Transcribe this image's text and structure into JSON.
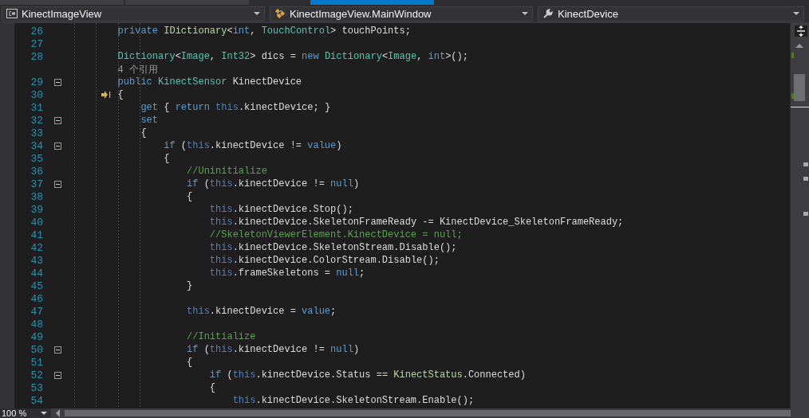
{
  "document_tabs": [
    {
      "selected": false
    },
    {
      "selected": false
    },
    {
      "selected": true
    }
  ],
  "navigation_bar": [
    {
      "kind": "project",
      "label": "KinectImageView"
    },
    {
      "kind": "class",
      "label": "KinectImageView.MainWindow"
    },
    {
      "kind": "member",
      "label": "KinectDevice"
    }
  ],
  "editor": {
    "lines": [
      {
        "kind": "code",
        "number": "26",
        "tokens": [
          {
            "kind": "kw",
            "text": "        private"
          },
          {
            "kind": "iface",
            "text": " IDictionary"
          },
          {
            "kind": "plain",
            "text": "<"
          },
          {
            "kind": "kw",
            "text": "int"
          },
          {
            "kind": "plain",
            "text": ", "
          },
          {
            "kind": "type",
            "text": "TouchControl"
          },
          {
            "kind": "plain",
            "text": "> touchPoints;"
          }
        ]
      },
      {
        "kind": "code",
        "number": "27"
      },
      {
        "kind": "code",
        "number": "28",
        "tokens": [
          {
            "kind": "type",
            "text": "        Dictionary"
          },
          {
            "kind": "plain",
            "text": "<"
          },
          {
            "kind": "type",
            "text": "Image"
          },
          {
            "kind": "plain",
            "text": ", "
          },
          {
            "kind": "type",
            "text": "Int32"
          },
          {
            "kind": "plain",
            "text": "> dics = "
          },
          {
            "kind": "kw",
            "text": "new"
          },
          {
            "kind": "type",
            "text": " Dictionary"
          },
          {
            "kind": "plain",
            "text": "<"
          },
          {
            "kind": "type",
            "text": "Image"
          },
          {
            "kind": "plain",
            "text": ", "
          },
          {
            "kind": "kw",
            "text": "int"
          },
          {
            "kind": "plain",
            "text": ">();"
          }
        ]
      },
      {
        "kind": "codelens",
        "text": "4 个引用"
      },
      {
        "kind": "code",
        "number": "29",
        "fold": true,
        "tokens": [
          {
            "kind": "kw",
            "text": "        public"
          },
          {
            "kind": "type",
            "text": " KinectSensor"
          },
          {
            "kind": "plain",
            "text": " KinectDevice"
          }
        ]
      },
      {
        "kind": "code",
        "number": "30",
        "current": true,
        "tokens": [
          {
            "kind": "plain",
            "text": "        {"
          }
        ]
      },
      {
        "kind": "code",
        "number": "31",
        "tokens": [
          {
            "kind": "kw",
            "text": "            get"
          },
          {
            "kind": "plain",
            "text": " { "
          },
          {
            "kind": "kw",
            "text": "return"
          },
          {
            "kind": "this",
            "text": " this"
          },
          {
            "kind": "plain",
            "text": ".kinectDevice; }"
          }
        ]
      },
      {
        "kind": "code",
        "number": "32",
        "fold": true,
        "tokens": [
          {
            "kind": "kw",
            "text": "            set"
          }
        ]
      },
      {
        "kind": "code",
        "number": "33",
        "tokens": [
          {
            "kind": "plain",
            "text": "            {"
          }
        ]
      },
      {
        "kind": "code",
        "number": "34",
        "fold": true,
        "tokens": [
          {
            "kind": "kw",
            "text": "                if"
          },
          {
            "kind": "plain",
            "text": " ("
          },
          {
            "kind": "this",
            "text": "this"
          },
          {
            "kind": "plain",
            "text": ".kinectDevice != "
          },
          {
            "kind": "kw",
            "text": "value"
          },
          {
            "kind": "plain",
            "text": ")"
          }
        ]
      },
      {
        "kind": "code",
        "number": "35",
        "tokens": [
          {
            "kind": "plain",
            "text": "                {"
          }
        ]
      },
      {
        "kind": "code",
        "number": "36",
        "tokens": [
          {
            "kind": "comment",
            "text": "                    //Uninitialize"
          }
        ]
      },
      {
        "kind": "code",
        "number": "37",
        "fold": true,
        "tokens": [
          {
            "kind": "kw",
            "text": "                    if"
          },
          {
            "kind": "plain",
            "text": " ("
          },
          {
            "kind": "this",
            "text": "this"
          },
          {
            "kind": "plain",
            "text": ".kinectDevice != "
          },
          {
            "kind": "kw",
            "text": "null"
          },
          {
            "kind": "plain",
            "text": ")"
          }
        ]
      },
      {
        "kind": "code",
        "number": "38",
        "tokens": [
          {
            "kind": "plain",
            "text": "                    {"
          }
        ]
      },
      {
        "kind": "code",
        "number": "39",
        "tokens": [
          {
            "kind": "this",
            "text": "                        this"
          },
          {
            "kind": "plain",
            "text": ".kinectDevice.Stop();"
          }
        ]
      },
      {
        "kind": "code",
        "number": "40",
        "tokens": [
          {
            "kind": "this",
            "text": "                        this"
          },
          {
            "kind": "plain",
            "text": ".kinectDevice.SkeletonFrameReady -= KinectDevice_SkeletonFrameReady;"
          }
        ]
      },
      {
        "kind": "code",
        "number": "41",
        "tokens": [
          {
            "kind": "comment",
            "text": "                        //SkeletonViewerElement.KinectDevice = null;"
          }
        ]
      },
      {
        "kind": "code",
        "number": "42",
        "tokens": [
          {
            "kind": "this",
            "text": "                        this"
          },
          {
            "kind": "plain",
            "text": ".kinectDevice.SkeletonStream.Disable();"
          }
        ]
      },
      {
        "kind": "code",
        "number": "43",
        "tokens": [
          {
            "kind": "this",
            "text": "                        this"
          },
          {
            "kind": "plain",
            "text": ".kinectDevice.ColorStream.Disable();"
          }
        ]
      },
      {
        "kind": "code",
        "number": "44",
        "tokens": [
          {
            "kind": "this",
            "text": "                        this"
          },
          {
            "kind": "plain",
            "text": ".frameSkeletons = "
          },
          {
            "kind": "kw",
            "text": "null"
          },
          {
            "kind": "plain",
            "text": ";"
          }
        ]
      },
      {
        "kind": "code",
        "number": "45",
        "tokens": [
          {
            "kind": "plain",
            "text": "                    }"
          }
        ]
      },
      {
        "kind": "code",
        "number": "46"
      },
      {
        "kind": "code",
        "number": "47",
        "tokens": [
          {
            "kind": "this",
            "text": "                    this"
          },
          {
            "kind": "plain",
            "text": ".kinectDevice = "
          },
          {
            "kind": "kw",
            "text": "value"
          },
          {
            "kind": "plain",
            "text": ";"
          }
        ]
      },
      {
        "kind": "code",
        "number": "48"
      },
      {
        "kind": "code",
        "number": "49",
        "tokens": [
          {
            "kind": "comment",
            "text": "                    //Initialize"
          }
        ]
      },
      {
        "kind": "code",
        "number": "50",
        "fold": true,
        "tokens": [
          {
            "kind": "kw",
            "text": "                    if"
          },
          {
            "kind": "plain",
            "text": " ("
          },
          {
            "kind": "this",
            "text": "this"
          },
          {
            "kind": "plain",
            "text": ".kinectDevice != "
          },
          {
            "kind": "kw",
            "text": "null"
          },
          {
            "kind": "plain",
            "text": ")"
          }
        ]
      },
      {
        "kind": "code",
        "number": "51",
        "tokens": [
          {
            "kind": "plain",
            "text": "                    {"
          }
        ]
      },
      {
        "kind": "code",
        "number": "52",
        "fold": true,
        "tokens": [
          {
            "kind": "kw",
            "text": "                        if"
          },
          {
            "kind": "plain",
            "text": " ("
          },
          {
            "kind": "this",
            "text": "this"
          },
          {
            "kind": "plain",
            "text": ".kinectDevice.Status == "
          },
          {
            "kind": "iface",
            "text": "KinectStatus"
          },
          {
            "kind": "plain",
            "text": ".Connected)"
          }
        ]
      },
      {
        "kind": "code",
        "number": "53",
        "tokens": [
          {
            "kind": "plain",
            "text": "                        {"
          }
        ]
      },
      {
        "kind": "code",
        "number": "54",
        "tokens": [
          {
            "kind": "this",
            "text": "                            this"
          },
          {
            "kind": "plain",
            "text": ".kinectDevice.SkeletonStream.Enable();"
          }
        ]
      }
    ]
  },
  "zoom": {
    "label": "100 %"
  }
}
